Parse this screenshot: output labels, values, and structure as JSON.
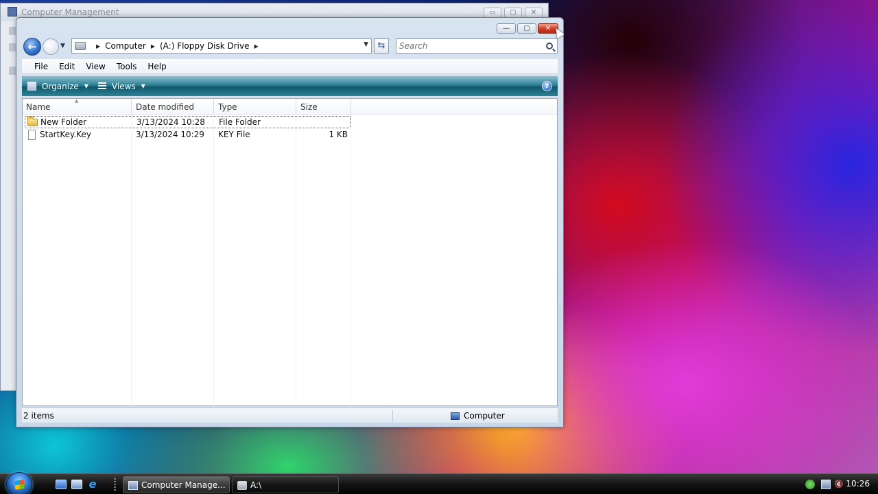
{
  "background_window": {
    "title": "Computer Management",
    "controls": [
      "▭",
      "▢",
      "✕"
    ]
  },
  "explorer": {
    "controls": {
      "minimize": "—",
      "maximize": "▢",
      "close": "✕"
    },
    "nav": {
      "back_glyph": "←"
    },
    "breadcrumb": [
      "Computer",
      "(A:) Floppy Disk Drive"
    ],
    "search": {
      "placeholder": "Search"
    },
    "menu": [
      "File",
      "Edit",
      "View",
      "Tools",
      "Help"
    ],
    "commands": {
      "organize": "Organize",
      "views": "Views",
      "help": "?"
    },
    "columns": [
      "Name",
      "Date modified",
      "Type",
      "Size"
    ],
    "files": [
      {
        "name": "New Folder",
        "date": "3/13/2024 10:28",
        "type": "File Folder",
        "size": "",
        "icon": "folder-icon",
        "selected": true
      },
      {
        "name": "StartKey.Key",
        "date": "3/13/2024 10:29",
        "type": "KEY File",
        "size": "1 KB",
        "icon": "file-icon",
        "selected": false
      }
    ],
    "status": {
      "item_count": "2 items",
      "location": "Computer"
    }
  },
  "taskbar": {
    "buttons": [
      {
        "label": "Computer Manage..."
      },
      {
        "label": "A:\\"
      }
    ],
    "tray": {
      "volume_glyph": "🔇",
      "clock": "10:26"
    }
  }
}
